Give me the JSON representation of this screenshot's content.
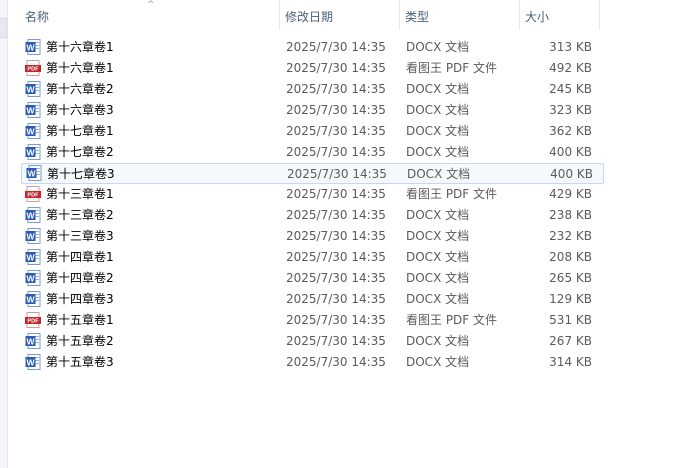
{
  "columns": {
    "name": "名称",
    "date": "修改日期",
    "type": "类型",
    "size": "大小"
  },
  "colors": {
    "word_blue": "#2b5bb5",
    "pdf_red": "#c0282c",
    "selected_bg": "#f5f9fe",
    "selected_border": "#c5d8f0"
  },
  "files": [
    {
      "name": "第十六章卷1",
      "date": "2025/7/30 14:35",
      "type": "DOCX 文档",
      "size": "313 KB",
      "icon": "word-doc-icon"
    },
    {
      "name": "第十六章卷1",
      "date": "2025/7/30 14:35",
      "type": "看图王 PDF 文件",
      "size": "492 KB",
      "icon": "pdf-file-icon"
    },
    {
      "name": "第十六章卷2",
      "date": "2025/7/30 14:35",
      "type": "DOCX 文档",
      "size": "245 KB",
      "icon": "word-doc-icon"
    },
    {
      "name": "第十六章卷3",
      "date": "2025/7/30 14:35",
      "type": "DOCX 文档",
      "size": "323 KB",
      "icon": "word-doc-icon"
    },
    {
      "name": "第十七章卷1",
      "date": "2025/7/30 14:35",
      "type": "DOCX 文档",
      "size": "362 KB",
      "icon": "word-doc-icon"
    },
    {
      "name": "第十七章卷2",
      "date": "2025/7/30 14:35",
      "type": "DOCX 文档",
      "size": "400 KB",
      "icon": "word-doc-icon"
    },
    {
      "name": "第十七章卷3",
      "date": "2025/7/30 14:35",
      "type": "DOCX 文档",
      "size": "400 KB",
      "icon": "word-doc-icon",
      "selected": true
    },
    {
      "name": "第十三章卷1",
      "date": "2025/7/30 14:35",
      "type": "看图王 PDF 文件",
      "size": "429 KB",
      "icon": "pdf-file-icon"
    },
    {
      "name": "第十三章卷2",
      "date": "2025/7/30 14:35",
      "type": "DOCX 文档",
      "size": "238 KB",
      "icon": "word-doc-icon"
    },
    {
      "name": "第十三章卷3",
      "date": "2025/7/30 14:35",
      "type": "DOCX 文档",
      "size": "232 KB",
      "icon": "word-doc-icon"
    },
    {
      "name": "第十四章卷1",
      "date": "2025/7/30 14:35",
      "type": "DOCX 文档",
      "size": "208 KB",
      "icon": "word-doc-icon"
    },
    {
      "name": "第十四章卷2",
      "date": "2025/7/30 14:35",
      "type": "DOCX 文档",
      "size": "265 KB",
      "icon": "word-doc-icon"
    },
    {
      "name": "第十四章卷3",
      "date": "2025/7/30 14:35",
      "type": "DOCX 文档",
      "size": "129 KB",
      "icon": "word-doc-icon"
    },
    {
      "name": "第十五章卷1",
      "date": "2025/7/30 14:35",
      "type": "看图王 PDF 文件",
      "size": "531 KB",
      "icon": "pdf-file-icon"
    },
    {
      "name": "第十五章卷2",
      "date": "2025/7/30 14:35",
      "type": "DOCX 文档",
      "size": "267 KB",
      "icon": "word-doc-icon"
    },
    {
      "name": "第十五章卷3",
      "date": "2025/7/30 14:35",
      "type": "DOCX 文档",
      "size": "314 KB",
      "icon": "word-doc-icon"
    }
  ]
}
